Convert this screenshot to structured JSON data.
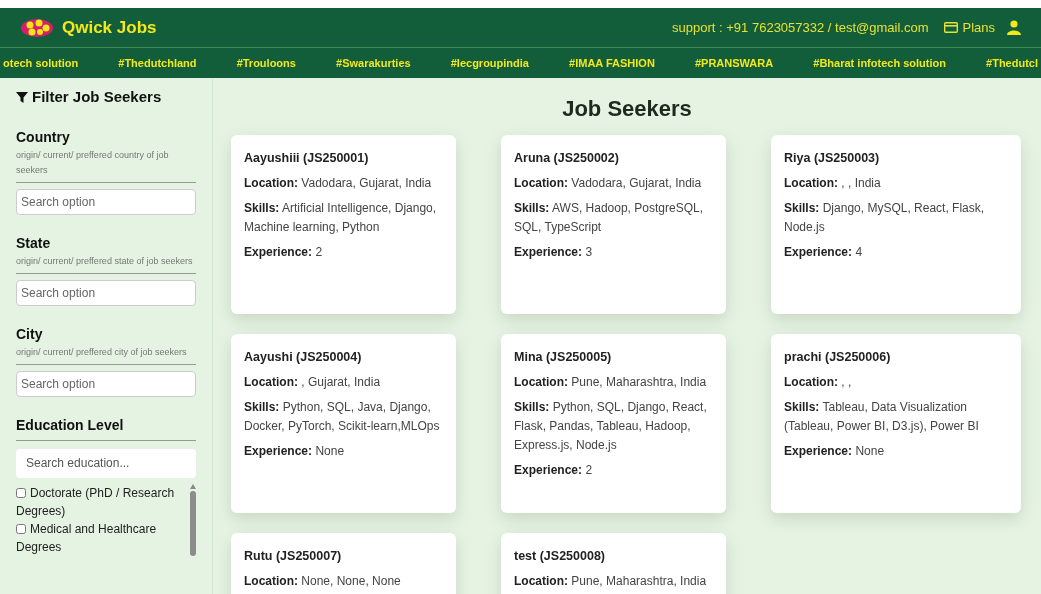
{
  "header": {
    "brand": "Qwick Jobs",
    "support": "support : +91 7623057332 / test@gmail.com",
    "plans": "Plans"
  },
  "ticker": [
    "otech solution",
    "#Thedutchland",
    "#Trouloons",
    "#Swarakurties",
    "#Iecgroupindia",
    "#IMAA FASHION",
    "#PRANSWARA",
    "#Bharat infotech solution",
    "#Thedutcl"
  ],
  "sidebar": {
    "title": "Filter Job Seekers",
    "filters": [
      {
        "label": "Country",
        "hint": "origin/ current/ preffered country of job seekers",
        "placeholder": "Search option"
      },
      {
        "label": "State",
        "hint": "origin/ current/ preffered state of job seekers",
        "placeholder": "Search option"
      },
      {
        "label": "City",
        "hint": "origin/ current/ preffered city of job seekers",
        "placeholder": "Search option"
      }
    ],
    "education": {
      "label": "Education Level",
      "placeholder": "Search education...",
      "options": [
        {
          "label": "Doctorate (PhD / Research Degrees)",
          "checked": false
        },
        {
          "label": "Medical and Healthcare Degrees",
          "checked": false
        }
      ]
    }
  },
  "main": {
    "title": "Job Seekers",
    "cards": [
      {
        "name": "Aayushiii (JS250001)",
        "fields": [
          {
            "label": "Location:",
            "value": "Vadodara, Gujarat, India"
          },
          {
            "label": "Skills:",
            "value": "Artificial Intelligence, Django, Machine learning, Python"
          },
          {
            "label": "Experience:",
            "value": "2"
          }
        ]
      },
      {
        "name": "Aruna (JS250002)",
        "fields": [
          {
            "label": "Location:",
            "value": "Vadodara, Gujarat, India"
          },
          {
            "label": "Skills:",
            "value": "AWS, Hadoop, PostgreSQL, SQL, TypeScript"
          },
          {
            "label": "Experience:",
            "value": "3"
          }
        ]
      },
      {
        "name": "Riya (JS250003)",
        "fields": [
          {
            "label": "Location:",
            "value": ", , India"
          },
          {
            "label": "Skills:",
            "value": "Django, MySQL, React, Flask, Node.js"
          },
          {
            "label": "Experience:",
            "value": "4"
          }
        ]
      },
      {
        "name": "Aayushi (JS250004)",
        "fields": [
          {
            "label": "Location:",
            "value": ", Gujarat, India"
          },
          {
            "label": "Skills:",
            "value": "Python, SQL, Java, Django, Docker, PyTorch, Scikit-learn,MLOps"
          },
          {
            "label": "Experience:",
            "value": "None"
          }
        ]
      },
      {
        "name": "Mina (JS250005)",
        "fields": [
          {
            "label": "Location:",
            "value": "Pune, Maharashtra, India"
          },
          {
            "label": "Skills:",
            "value": "Python, SQL, Django, React, Flask, Pandas, Tableau, Hadoop, Express.js, Node.js"
          },
          {
            "label": "Experience:",
            "value": "2"
          }
        ]
      },
      {
        "name": "prachi (JS250006)",
        "fields": [
          {
            "label": "Location:",
            "value": ", ,"
          },
          {
            "label": "Skills:",
            "value": "Tableau, Data Visualization (Tableau, Power BI, D3.js), Power BI"
          },
          {
            "label": "Experience:",
            "value": "None"
          }
        ]
      },
      {
        "name": "Rutu (JS250007)",
        "fields": [
          {
            "label": "Location:",
            "value": "None, None, None"
          }
        ]
      },
      {
        "name": "test (JS250008)",
        "fields": [
          {
            "label": "Location:",
            "value": "Pune, Maharashtra, India"
          }
        ]
      }
    ]
  }
}
